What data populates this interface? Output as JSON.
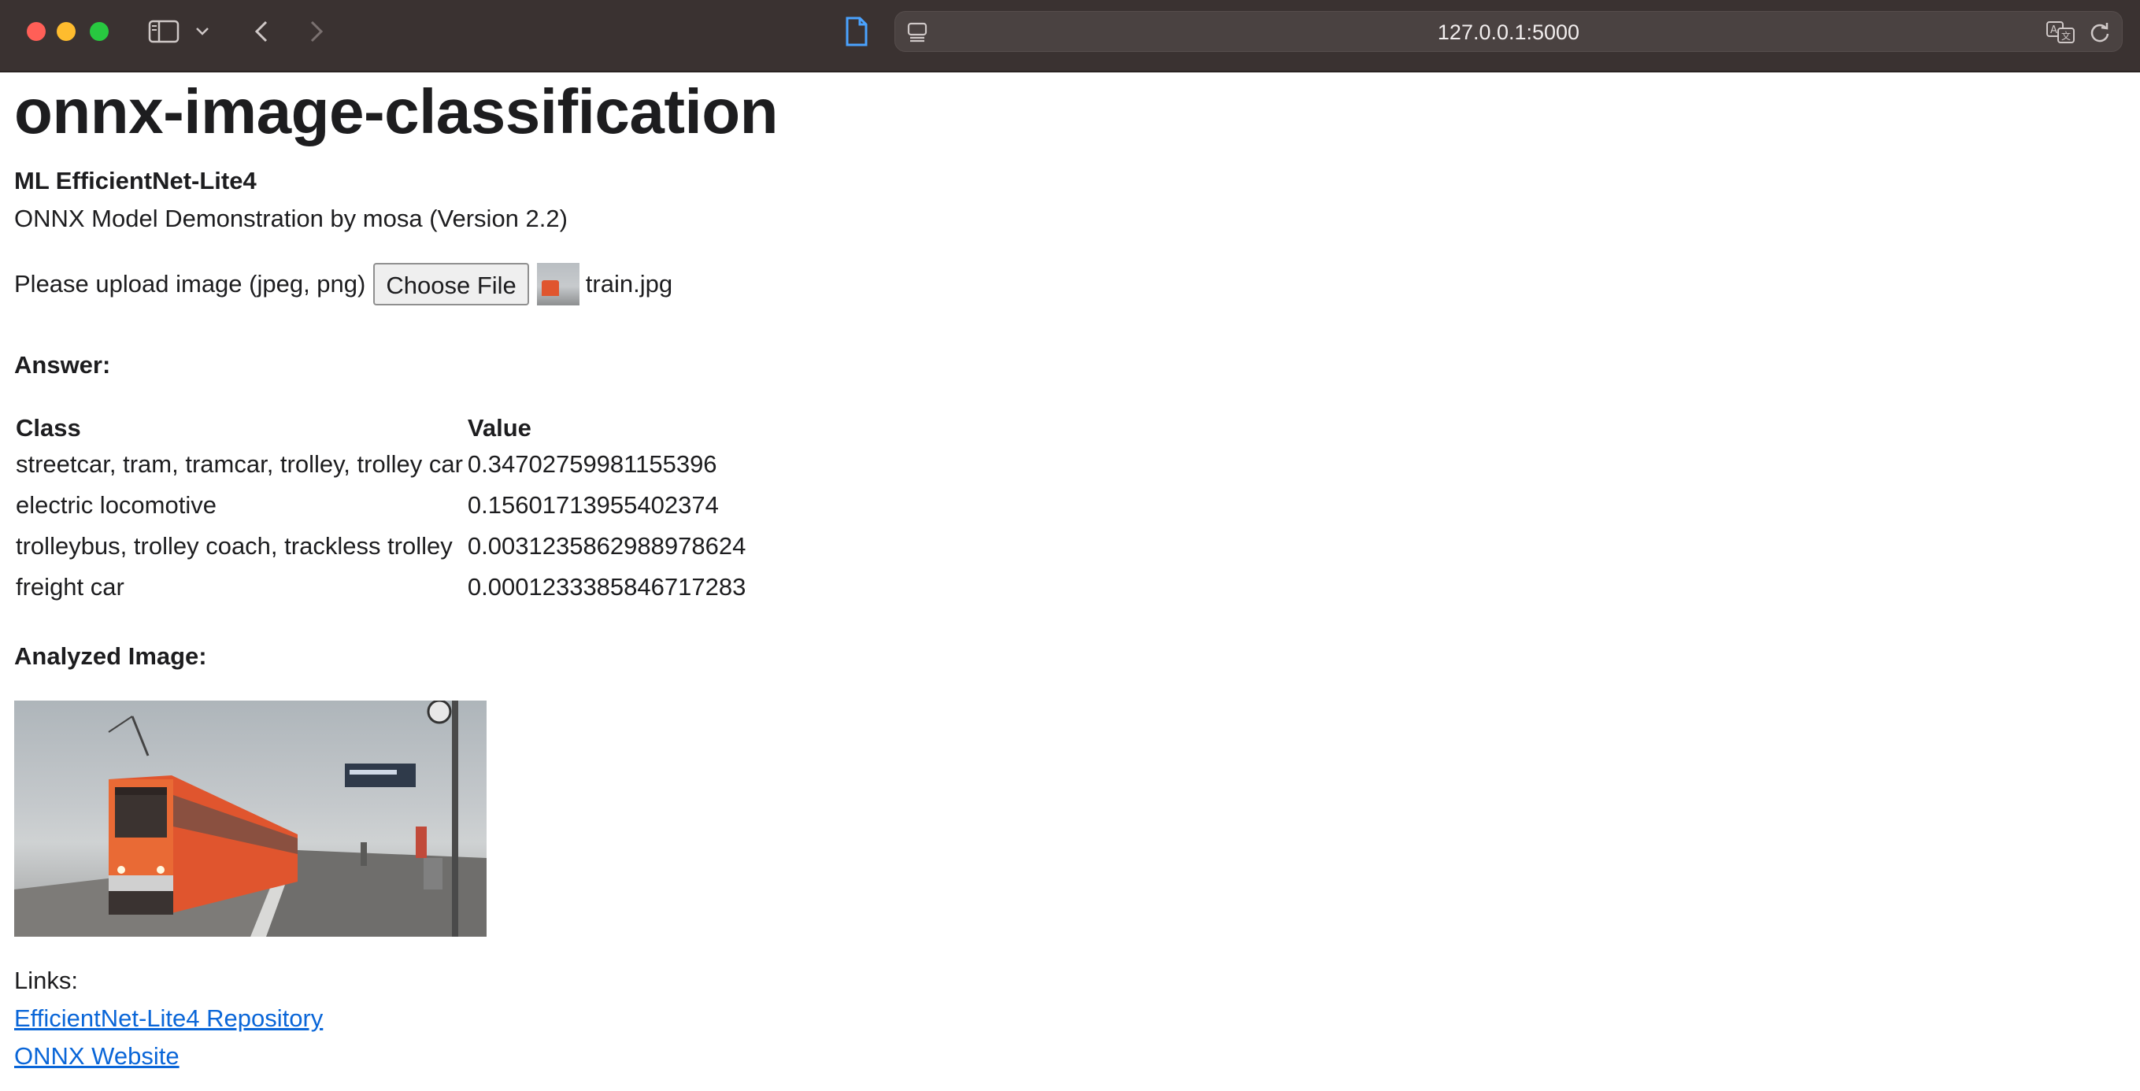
{
  "browser": {
    "url": "127.0.0.1:5000"
  },
  "page": {
    "title": "onnx-image-classification",
    "model_name": "ML EfficientNet-Lite4",
    "description": "ONNX Model Demonstration by mosa (Version 2.2)",
    "upload": {
      "label": "Please upload image (jpeg, png)",
      "button_label": "Choose File",
      "file_name": "train.jpg"
    },
    "answer_heading": "Answer:",
    "table": {
      "headers": [
        "Class",
        "Value"
      ],
      "rows": [
        [
          "streetcar, tram, tramcar, trolley, trolley car",
          "0.34702759981155396"
        ],
        [
          "electric locomotive",
          "0.15601713955402374"
        ],
        [
          "trolleybus, trolley coach, trackless trolley",
          "0.0031235862988978624"
        ],
        [
          "freight car",
          "0.0001233385846717283"
        ]
      ]
    },
    "analyzed_heading": "Analyzed Image:",
    "links_label": "Links:",
    "links": [
      "EfficientNet-Lite4 Repository",
      "ONNX Website"
    ]
  },
  "colors": {
    "toolbar_bg": "#3a3231",
    "link": "#0a66d8",
    "train_orange": "#e0552e"
  }
}
